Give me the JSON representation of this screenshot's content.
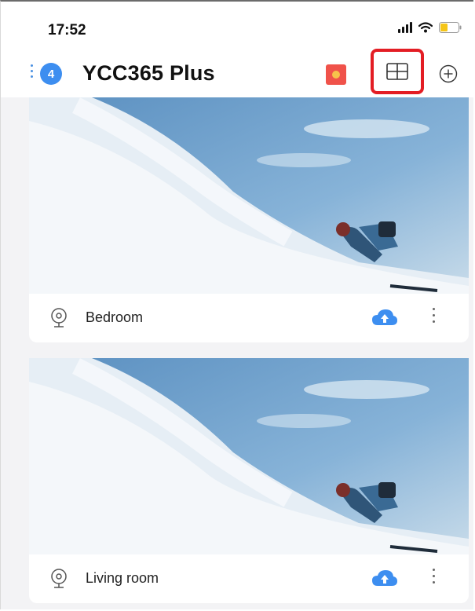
{
  "status_bar": {
    "time": "17:52"
  },
  "header": {
    "device_count": "4",
    "title": "YCC365 Plus"
  },
  "icons": {
    "gift": "gift-icon",
    "grid_view": "grid-view-icon",
    "add": "plus-circle-icon",
    "camera": "camera-icon",
    "cloud": "cloud-upload-icon",
    "more": "more-vertical-icon"
  },
  "colors": {
    "accent": "#3d8ef0",
    "highlight_box": "#e31d24",
    "gift": "#f0524a"
  },
  "devices": [
    {
      "name": "Bedroom"
    },
    {
      "name": "Living room"
    }
  ]
}
